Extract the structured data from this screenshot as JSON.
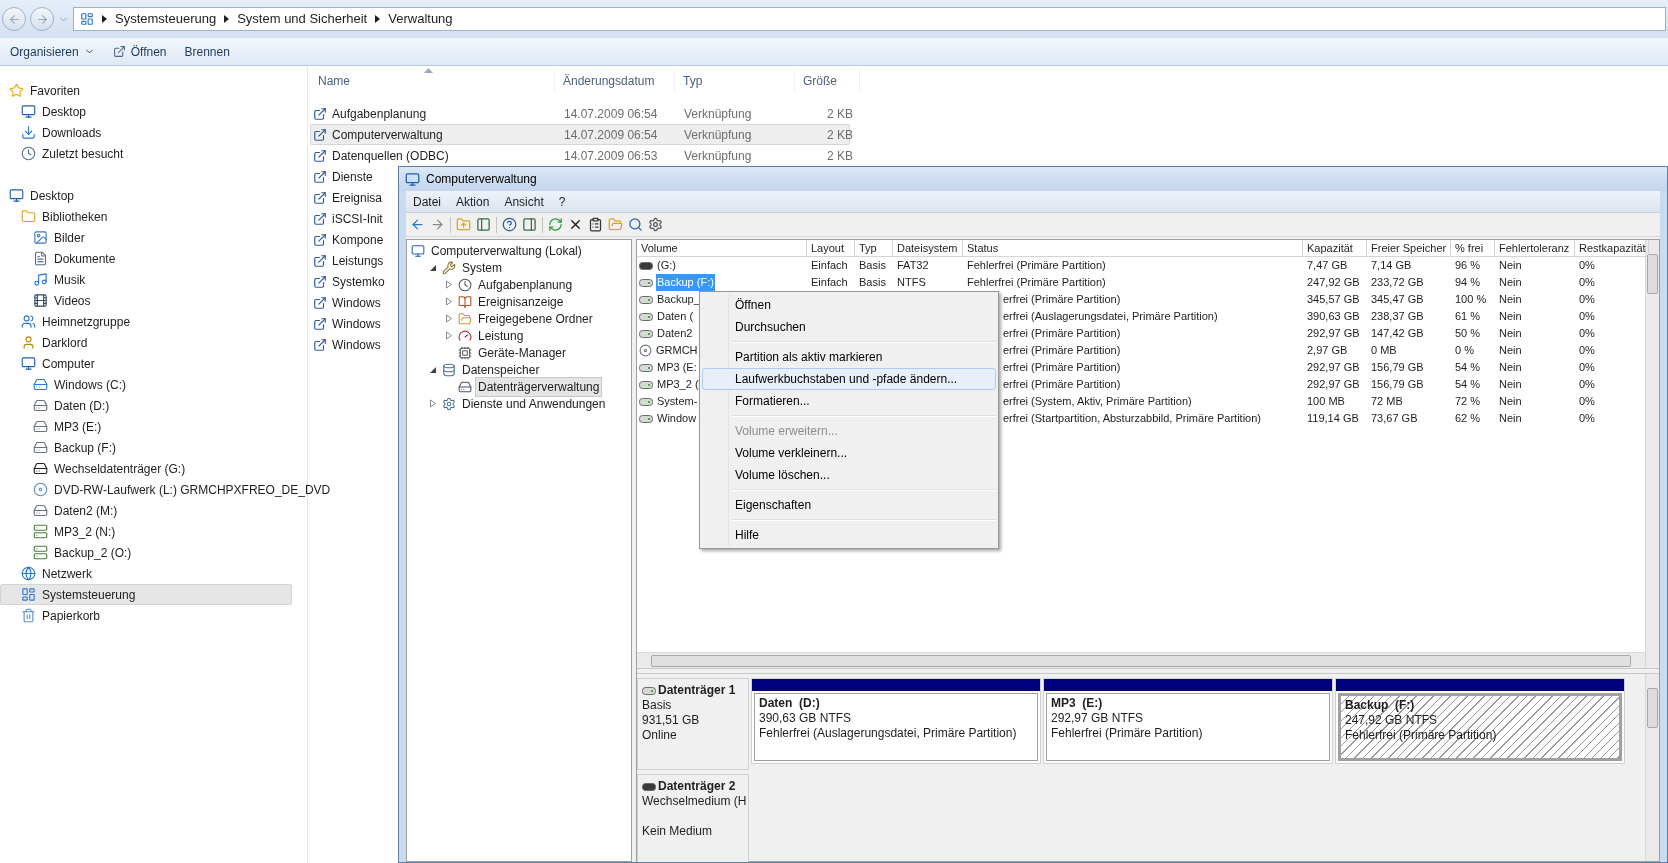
{
  "explorer": {
    "breadcrumb": [
      "Systemsteuerung",
      "System und Sicherheit",
      "Verwaltung"
    ],
    "toolbar": [
      {
        "label": "Organisieren",
        "kind": "dropdown"
      },
      {
        "label": "Öffnen",
        "kind": "open"
      },
      {
        "label": "Brennen",
        "kind": "plain"
      }
    ],
    "nav": [
      {
        "label": "Favoriten",
        "kind": "star",
        "selected": false,
        "children": [
          {
            "label": "Desktop",
            "kind": "desktop",
            "selected": false
          },
          {
            "label": "Downloads",
            "kind": "download",
            "selected": false
          },
          {
            "label": "Zuletzt besucht",
            "kind": "recent",
            "selected": false
          }
        ]
      },
      {
        "label": "Desktop",
        "kind": "desktop",
        "selected": false,
        "children": [
          {
            "label": "Bibliotheken",
            "kind": "library",
            "selected": false,
            "children": [
              {
                "label": "Bilder",
                "kind": "image",
                "selected": false
              },
              {
                "label": "Dokumente",
                "kind": "document",
                "selected": false
              },
              {
                "label": "Musik",
                "kind": "music",
                "selected": false
              },
              {
                "label": "Videos",
                "kind": "video",
                "selected": false
              }
            ]
          },
          {
            "label": "Heimnetzgruppe",
            "kind": "homegroup",
            "selected": false
          },
          {
            "label": "Darklord",
            "kind": "user",
            "selected": false
          },
          {
            "label": "Computer",
            "kind": "computer",
            "selected": false,
            "children": [
              {
                "label": "Windows (C:)",
                "kind": "system-drive",
                "selected": false
              },
              {
                "label": "Daten (D:)",
                "kind": "drive",
                "selected": false
              },
              {
                "label": "MP3 (E:)",
                "kind": "drive",
                "selected": false
              },
              {
                "label": "Backup (F:)",
                "kind": "drive",
                "selected": false
              },
              {
                "label": "Wechseldatenträger (G:)",
                "kind": "removable",
                "selected": false
              },
              {
                "label": "DVD-RW-Laufwerk (L:) GRMCHPXFREO_DE_DVD",
                "kind": "dvd",
                "selected": false
              },
              {
                "label": "Daten2 (M:)",
                "kind": "drive",
                "selected": false
              },
              {
                "label": "MP3_2 (N:)",
                "kind": "network-drive",
                "selected": false
              },
              {
                "label": "Backup_2 (O:)",
                "kind": "network-drive",
                "selected": false
              }
            ]
          },
          {
            "label": "Netzwerk",
            "kind": "network",
            "selected": false
          },
          {
            "label": "Systemsteuerung",
            "kind": "control-panel",
            "selected": true
          },
          {
            "label": "Papierkorb",
            "kind": "trash",
            "selected": false
          }
        ]
      }
    ],
    "files": {
      "columns": [
        "Name",
        "Änderungsdatum",
        "Typ",
        "Größe"
      ],
      "rows": [
        {
          "name": "Aufgabenplanung",
          "date": "14.07.2009 06:54",
          "type": "Verknüpfung",
          "size": "2 KB",
          "selected": false
        },
        {
          "name": "Computerverwaltung",
          "date": "14.07.2009 06:54",
          "type": "Verknüpfung",
          "size": "2 KB",
          "selected": true
        },
        {
          "name": "Datenquellen (ODBC)",
          "date": "14.07.2009 06:53",
          "type": "Verknüpfung",
          "size": "2 KB",
          "selected": false
        },
        {
          "name": "Dienste",
          "selected": false
        },
        {
          "name": "Ereignisa",
          "selected": false
        },
        {
          "name": "iSCSI-Init",
          "selected": false
        },
        {
          "name": "Kompone",
          "selected": false
        },
        {
          "name": "Leistungs",
          "selected": false
        },
        {
          "name": "Systemko",
          "selected": false
        },
        {
          "name": "Windows",
          "selected": false
        },
        {
          "name": "Windows",
          "selected": false
        },
        {
          "name": "Windows",
          "selected": false
        }
      ]
    }
  },
  "mmc": {
    "title": "Computerverwaltung",
    "menu": [
      "Datei",
      "Aktion",
      "Ansicht",
      "?"
    ],
    "tree": [
      {
        "label": "Computerverwaltung (Lokal)",
        "kind": "computer",
        "selected": false,
        "children": [
          {
            "label": "System",
            "kind": "tools",
            "expanded": true,
            "selected": false,
            "children": [
              {
                "label": "Aufgabenplanung",
                "kind": "clock",
                "expanded": false,
                "selected": false
              },
              {
                "label": "Ereignisanzeige",
                "kind": "log",
                "expanded": false,
                "selected": false
              },
              {
                "label": "Freigegebene Ordner",
                "kind": "shared",
                "expanded": false,
                "selected": false
              },
              {
                "label": "Leistung",
                "kind": "gauge",
                "expanded": false,
                "selected": false
              },
              {
                "label": "Geräte-Manager",
                "kind": "devices",
                "selected": false
              }
            ]
          },
          {
            "label": "Datenspeicher",
            "kind": "storage",
            "expanded": true,
            "selected": false,
            "children": [
              {
                "label": "Datenträgerverwaltung",
                "kind": "disk",
                "selected": true
              }
            ]
          },
          {
            "label": "Dienste und Anwendungen",
            "kind": "services",
            "expanded": false,
            "selected": false
          }
        ]
      }
    ],
    "volumes": {
      "columns": [
        "Volume",
        "Layout",
        "Typ",
        "Dateisystem",
        "Status",
        "Kapazität",
        "Freier Speicher",
        "% frei",
        "Fehlertoleranz",
        "Restkapazität"
      ],
      "rows": [
        {
          "kind": "removable",
          "volume": "(G:)",
          "layout": "Einfach",
          "type": "Basis",
          "fs": "FAT32",
          "status": "Fehlerfrei (Primäre Partition)",
          "capacity": "7,47 GB",
          "free": "7,14 GB",
          "pct": "96 %",
          "fault": "Nein",
          "rest": "0%",
          "selected": false
        },
        {
          "kind": "drive",
          "volume": "Backup (F:)",
          "layout": "Einfach",
          "type": "Basis",
          "fs": "NTFS",
          "status": "Fehlerfrei (Primäre Partition)",
          "capacity": "247,92 GB",
          "free": "233,72 GB",
          "pct": "94 %",
          "fault": "Nein",
          "rest": "0%",
          "selected": true
        },
        {
          "kind": "drive",
          "volume": "Backup_",
          "status": "erfrei (Primäre Partition)",
          "capacity": "345,57 GB",
          "free": "345,47 GB",
          "pct": "100 %",
          "fault": "Nein",
          "rest": "0%",
          "selected": false
        },
        {
          "kind": "drive",
          "volume": "Daten (",
          "status": "erfrei (Auslagerungsdatei, Primäre Partition)",
          "capacity": "390,63 GB",
          "free": "238,37 GB",
          "pct": "61 %",
          "fault": "Nein",
          "rest": "0%",
          "selected": false
        },
        {
          "kind": "drive",
          "volume": "Daten2",
          "status": "erfrei (Primäre Partition)",
          "capacity": "292,97 GB",
          "free": "147,42 GB",
          "pct": "50 %",
          "fault": "Nein",
          "rest": "0%",
          "selected": false
        },
        {
          "kind": "dvd",
          "volume": "GRMCH",
          "status": "erfrei (Primäre Partition)",
          "capacity": "2,97 GB",
          "free": "0 MB",
          "pct": "0 %",
          "fault": "Nein",
          "rest": "0%",
          "selected": false
        },
        {
          "kind": "drive",
          "volume": "MP3 (E:",
          "status": "erfrei (Primäre Partition)",
          "capacity": "292,97 GB",
          "free": "156,79 GB",
          "pct": "54 %",
          "fault": "Nein",
          "rest": "0%",
          "selected": false
        },
        {
          "kind": "drive",
          "volume": "MP3_2 (",
          "status": "erfrei (Primäre Partition)",
          "capacity": "292,97 GB",
          "free": "156,79 GB",
          "pct": "54 %",
          "fault": "Nein",
          "rest": "0%",
          "selected": false
        },
        {
          "kind": "drive",
          "volume": "System-",
          "status": "erfrei (System, Aktiv, Primäre Partition)",
          "capacity": "100 MB",
          "free": "72 MB",
          "pct": "72 %",
          "fault": "Nein",
          "rest": "0%",
          "selected": false
        },
        {
          "kind": "drive",
          "volume": "Window",
          "status": "erfrei (Startpartition, Absturzabbild, Primäre Partition)",
          "capacity": "119,14 GB",
          "free": "73,67 GB",
          "pct": "62 %",
          "fault": "Nein",
          "rest": "0%",
          "selected": false
        }
      ]
    },
    "context_menu": {
      "groups": [
        [
          {
            "label": "Öffnen",
            "disabled": false,
            "selected": false
          },
          {
            "label": "Durchsuchen",
            "disabled": false,
            "selected": false
          }
        ],
        [
          {
            "label": "Partition als aktiv markieren",
            "disabled": false,
            "selected": false
          },
          {
            "label": "Laufwerkbuchstaben und -pfade ändern...",
            "disabled": false,
            "selected": true
          },
          {
            "label": "Formatieren...",
            "disabled": false,
            "selected": false
          }
        ],
        [
          {
            "label": "Volume erweitern...",
            "disabled": true,
            "selected": false
          },
          {
            "label": "Volume verkleinern...",
            "disabled": false,
            "selected": false
          },
          {
            "label": "Volume löschen...",
            "disabled": false,
            "selected": false
          }
        ],
        [
          {
            "label": "Eigenschaften",
            "disabled": false,
            "selected": false
          }
        ],
        [
          {
            "label": "Hilfe",
            "disabled": false,
            "selected": false
          }
        ]
      ]
    },
    "disks": [
      {
        "kind": "fixed",
        "name": "Datenträger 1",
        "type": "Basis",
        "size": "931,51 GB",
        "status": "Online",
        "partitions": [
          {
            "title": "Daten  (D:)",
            "size": "390,63 GB NTFS",
            "status": "Fehlerfrei (Auslagerungsdatei, Primäre Partition)",
            "selected": false
          },
          {
            "title": "MP3  (E:)",
            "size": "292,97 GB NTFS",
            "status": "Fehlerfrei (Primäre Partition)",
            "selected": false
          },
          {
            "title": "Backup  (F:)",
            "size": "247,92 GB NTFS",
            "status": "Fehlerfrei (Primäre Partition)",
            "selected": true
          }
        ]
      },
      {
        "kind": "removable",
        "name": "Datenträger 2",
        "type": "Wechselmedium (H",
        "status": "Kein Medium"
      }
    ]
  }
}
